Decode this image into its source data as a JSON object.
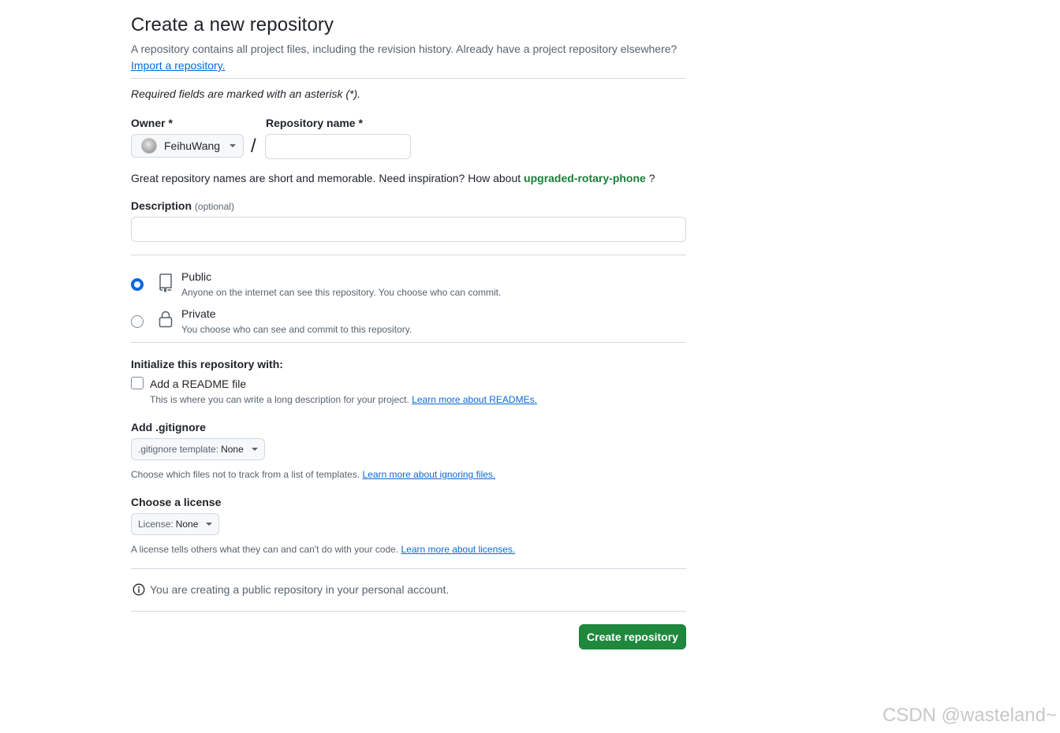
{
  "page": {
    "title": "Create a new repository",
    "subtitle": "A repository contains all project files, including the revision history. Already have a project repository elsewhere?",
    "import_link": "Import a repository.",
    "required_note": "Required fields are marked with an asterisk (*)."
  },
  "owner": {
    "label": "Owner *",
    "value": "FeihuWang"
  },
  "separator": "/",
  "repo_name": {
    "label": "Repository name *",
    "value": "",
    "placeholder": ""
  },
  "name_hint": {
    "text": "Great repository names are short and memorable. Need inspiration? How about",
    "suggestion": "upgraded-rotary-phone",
    "end": "?"
  },
  "description": {
    "label": "Description",
    "optional": "(optional)",
    "value": "",
    "placeholder": ""
  },
  "visibility": {
    "selected": "public",
    "public": {
      "title": "Public",
      "desc": "Anyone on the internet can see this repository. You choose who can commit.",
      "icon": "repo-icon"
    },
    "private": {
      "title": "Private",
      "desc": "You choose who can see and commit to this repository.",
      "icon": "lock-icon"
    }
  },
  "init": {
    "heading": "Initialize this repository with:",
    "readme": {
      "label": "Add a README file",
      "checked": false,
      "desc": "This is where you can write a long description for your project.",
      "link": "Learn more about READMEs."
    }
  },
  "gitignore": {
    "heading": "Add .gitignore",
    "select_prefix": ".gitignore template:",
    "select_value": "None",
    "desc": "Choose which files not to track from a list of templates.",
    "link": "Learn more about ignoring files."
  },
  "license": {
    "heading": "Choose a license",
    "select_prefix": "License:",
    "select_value": "None",
    "desc": "A license tells others what they can and can't do with your code.",
    "link": "Learn more about licenses."
  },
  "notice": {
    "icon": "info-icon",
    "text": "You are creating a public repository in your personal account."
  },
  "submit": {
    "label": "Create repository"
  },
  "watermark": "CSDN @wasteland~",
  "colors": {
    "accent_blue": "#0969da",
    "success_green": "#1f883d",
    "suggestion_green": "#1a7f37",
    "border": "#d1d9e0",
    "muted_text": "#59636e"
  }
}
